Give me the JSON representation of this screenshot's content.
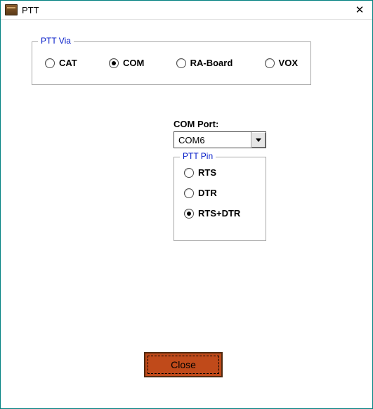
{
  "window": {
    "title": "PTT",
    "close_glyph": "✕"
  },
  "ptt_via": {
    "legend": "PTT Via",
    "options": [
      "CAT",
      "COM",
      "RA-Board",
      "VOX"
    ],
    "selected_index": 1
  },
  "com_port": {
    "label": "COM Port:",
    "value": "COM6"
  },
  "ptt_pin": {
    "legend": "PTT Pin",
    "options": [
      "RTS",
      "DTR",
      "RTS+DTR"
    ],
    "selected_index": 2
  },
  "buttons": {
    "close": "Close"
  }
}
